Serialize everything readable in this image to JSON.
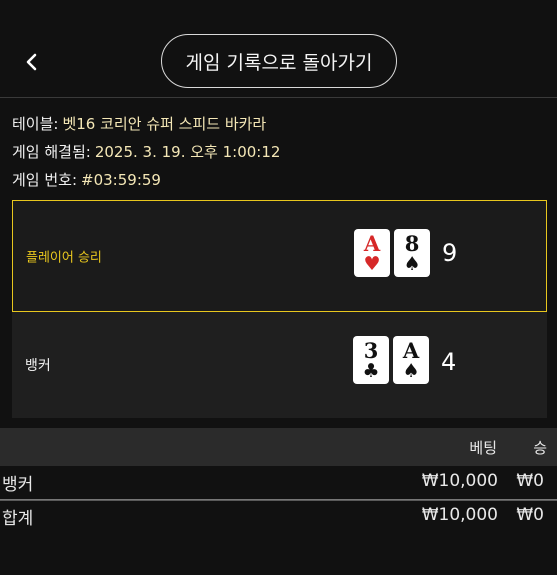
{
  "header": {
    "back_label": "<",
    "history_button": "게임 기록으로 돌아가기"
  },
  "info": {
    "table_label": "테이블:",
    "table_value": "벳16 코리안 슈퍼 스피드 바카라",
    "resolved_label": "게임 해결됨:",
    "resolved_value": "2025. 3. 19. 오후 1:00:12",
    "game_no_label": "게임 번호:",
    "game_no_value": "#03:59:59"
  },
  "player": {
    "label": "플레이어 승리",
    "cards": [
      {
        "rank": "A",
        "suit": "♥",
        "color": "red"
      },
      {
        "rank": "8",
        "suit": "♠",
        "color": "black"
      }
    ],
    "total": "9",
    "highlight_color": "#e8c71e"
  },
  "banker": {
    "label": "뱅커",
    "cards": [
      {
        "rank": "3",
        "suit": "♣",
        "color": "black"
      },
      {
        "rank": "A",
        "suit": "♠",
        "color": "black"
      }
    ],
    "total": "4"
  },
  "bets": {
    "headers": {
      "bet": "베팅",
      "win": "승"
    },
    "rows": [
      {
        "name": "뱅커",
        "bet": "₩10,000",
        "win": "₩0"
      },
      {
        "name": "합계",
        "bet": "₩10,000",
        "win": "₩0"
      }
    ]
  }
}
